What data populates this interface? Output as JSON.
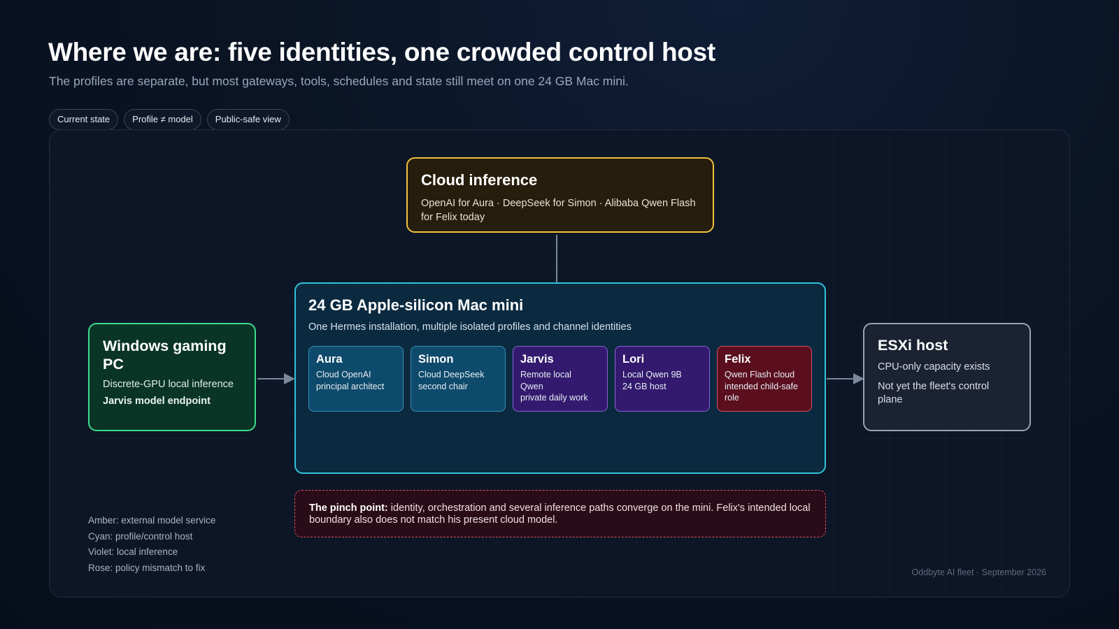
{
  "title": "Where we are: five identities, one crowded control host",
  "subtitle": "The profiles are separate, but most gateways, tools, schedules and state still meet on one 24 GB Mac mini.",
  "tags": [
    "Current state",
    "Profile ≠ model",
    "Public-safe view"
  ],
  "cloud": {
    "title": "Cloud inference",
    "desc": "OpenAI for Aura · DeepSeek for Simon · Alibaba Qwen Flash for Felix today"
  },
  "mini": {
    "title": "24 GB Apple-silicon Mac mini",
    "desc": "One Hermes installation, multiple isolated profiles and channel identities",
    "profiles": [
      {
        "name": "Aura",
        "line1": "Cloud OpenAI",
        "line2": "principal architect",
        "line3": ""
      },
      {
        "name": "Simon",
        "line1": "Cloud DeepSeek",
        "line2": "second chair",
        "line3": ""
      },
      {
        "name": "Jarvis",
        "line1": "Remote local",
        "line2": "Qwen",
        "line3": "private daily work"
      },
      {
        "name": "Lori",
        "line1": "Local Qwen 9B",
        "line2": "24 GB host",
        "line3": ""
      },
      {
        "name": "Felix",
        "line1": "Qwen Flash cloud",
        "line2": "intended child-safe",
        "line3": "role"
      }
    ]
  },
  "pc": {
    "title": "Windows gaming PC",
    "desc": "Discrete-GPU local inference",
    "bold": "Jarvis model endpoint"
  },
  "esxi": {
    "title": "ESXi host",
    "desc1": "CPU-only capacity exists",
    "desc2": "Not yet the fleet's control plane"
  },
  "pinch": {
    "label": "The pinch point:",
    "text": " identity, orchestration and several inference paths converge on the mini. Felix's intended local boundary also does not match his present cloud model."
  },
  "legend": [
    "Amber: external model service",
    "Cyan: profile/control host",
    "Violet: local inference",
    "Rose: policy mismatch to fix"
  ],
  "footer": "Oddbyte AI fleet · September 2026",
  "colors": {
    "amber": "#f0c23b",
    "cyan": "#2fc4dc",
    "green": "#3ddc8c",
    "violet": "#8a62d8",
    "rose": "#d8506c",
    "grey": "#9aa4b4"
  }
}
